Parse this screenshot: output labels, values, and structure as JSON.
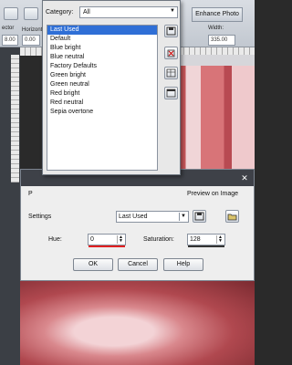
{
  "app": {
    "toolbar": {
      "horizontal_label": "Horizontal",
      "horizontal_value": "0.00",
      "width_label": "Width:",
      "width_value": "335.00",
      "left_value": "8.00",
      "selector_label": "ector",
      "enhance_label": "Enhance Photo"
    }
  },
  "preset_panel": {
    "category_label": "Category:",
    "category_value": "All",
    "presets": [
      {
        "label": "Last Used",
        "selected": true
      },
      {
        "label": "Default",
        "selected": false
      },
      {
        "label": "Blue bright",
        "selected": false
      },
      {
        "label": "Blue neutral",
        "selected": false
      },
      {
        "label": "Factory Defaults",
        "selected": false
      },
      {
        "label": "Green bright",
        "selected": false
      },
      {
        "label": "Green neutral",
        "selected": false
      },
      {
        "label": "Red bright",
        "selected": false
      },
      {
        "label": "Red neutral",
        "selected": false
      },
      {
        "label": "Sepia overtone",
        "selected": false
      }
    ]
  },
  "adjust_dialog": {
    "p_label": "P",
    "preview_label": "Preview on Image",
    "settings_label": "Settings",
    "settings_value": "Last Used",
    "hue_label": "Hue:",
    "hue_value": "0",
    "saturation_label": "Saturation:",
    "saturation_value": "128",
    "ok_label": "OK",
    "cancel_label": "Cancel",
    "help_label": "Help"
  },
  "colors": {
    "selection": "#2f6fd6",
    "hue_bar": "#e02020",
    "saturation_bar": "#333333"
  }
}
